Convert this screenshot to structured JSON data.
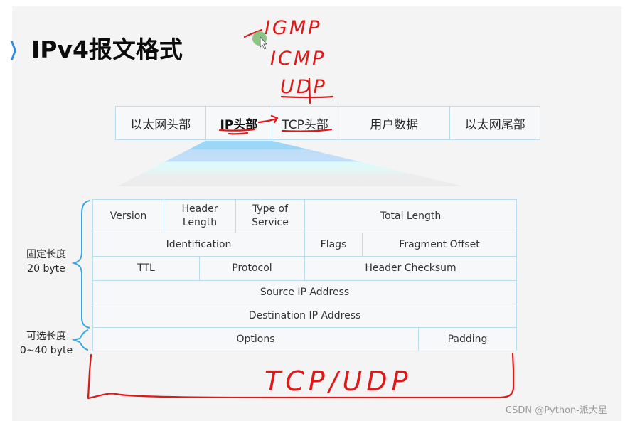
{
  "slide": {
    "title": "IPv4报文格式",
    "accent_color": "#2a8ee8"
  },
  "packet_bar": {
    "segments": [
      {
        "label": "以太网头部",
        "emphasis": false
      },
      {
        "label": "IP头部",
        "emphasis": true
      },
      {
        "label": "TCP头部",
        "emphasis": false
      },
      {
        "label": "用户数据",
        "emphasis": false
      },
      {
        "label": "以太网尾部",
        "emphasis": false
      }
    ]
  },
  "ip_header": {
    "rows": [
      [
        {
          "label": "Version"
        },
        {
          "label": "Header Length",
          "lines": [
            "Header",
            "Length"
          ]
        },
        {
          "label": "Type of Service",
          "lines": [
            "Type of",
            "Service"
          ]
        },
        {
          "label": "Total Length"
        }
      ],
      [
        {
          "label": "Identification"
        },
        {
          "label": "Flags"
        },
        {
          "label": "Fragment Offset"
        }
      ],
      [
        {
          "label": "TTL"
        },
        {
          "label": "Protocol"
        },
        {
          "label": "Header Checksum"
        }
      ],
      [
        {
          "label": "Source IP Address"
        }
      ],
      [
        {
          "label": "Destination IP Address"
        }
      ],
      [
        {
          "label": "Options"
        },
        {
          "label": "Padding"
        }
      ]
    ],
    "fixed_length": {
      "label": "固定长度",
      "size": "20 byte"
    },
    "optional_length": {
      "label": "可选长度",
      "size": "0~40 byte"
    },
    "brace_color": "#3aa7e0"
  },
  "annotations": {
    "color": "#e01818",
    "protocol_list": [
      "IGMP",
      "ICMP",
      "UDP"
    ],
    "payload_note": "TCP/UDP"
  },
  "watermark": "CSDN @Python-派大星"
}
